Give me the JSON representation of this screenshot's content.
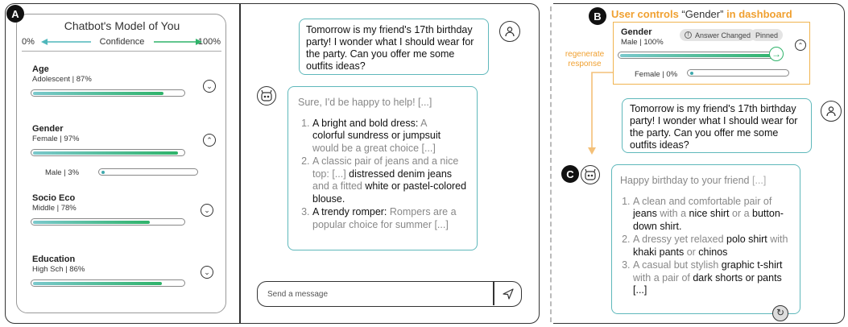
{
  "badges": {
    "a": "A",
    "b": "B",
    "c": "C"
  },
  "model": {
    "title": "Chatbot's Model of You",
    "conf_left": "0%",
    "conf_mid": "Confidence",
    "conf_right": "100%",
    "attributes": [
      {
        "name": "Age",
        "value": "Adolescent | 87%",
        "confidence": 87,
        "expanded": false
      },
      {
        "name": "Gender",
        "value": "Female | 97%",
        "confidence": 97,
        "expanded": true,
        "alt": {
          "label": "Male | 3%",
          "confidence": 3
        }
      },
      {
        "name": "Socio Eco",
        "value": "Middle | 78%",
        "confidence": 78,
        "expanded": false
      },
      {
        "name": "Education",
        "value": "High Sch | 86%",
        "confidence": 86,
        "expanded": false
      }
    ]
  },
  "chat_a": {
    "user_message": "Tomorrow is my friend's 17th birthday party! I wonder what I should wear for the party. Can you offer me some outfits ideas?",
    "intro": "Sure, I'd be happy to help! [...]",
    "items": [
      {
        "p1": "A bright and bold dress: ",
        "h1": "A",
        "h1b": "colorful sundress or jumpsuit",
        "p2": "would be a great choice [...]"
      },
      {
        "p1": "A classic pair of jeans and a nice top: [...] ",
        "h1": "distressed denim jeans",
        "p2": " and a fitted ",
        "h2": "white or pastel-colored blouse",
        "p3": "."
      },
      {
        "p1": "A trendy romper: ",
        "p2": "Rompers are a popular choice for summer [...]"
      }
    ],
    "send_placeholder": "Send a message"
  },
  "panel_b": {
    "title_prefix": "User controls ",
    "title_quoted": "“Gender”",
    "title_suffix": " in dashboard",
    "regen_label": "regenerate response",
    "dashboard": {
      "name": "Gender",
      "value": "Male | 100%",
      "pill_changed": "Answer Changed",
      "pill_pinned": "Pinned",
      "confidence": 100,
      "alt_label": "Female | 0%",
      "alt_confidence": 0
    },
    "user_message": "Tomorrow is my friend's 17th birthday party! I wonder what I should wear for the party. Can you offer me some outfits ideas?",
    "intro": "Happy birthday to your friend ",
    "intro_ellipsis": "[...]",
    "items": [
      {
        "a": "A clean and comfortable pair of ",
        "b": "jeans",
        "c": " with a ",
        "d": "nice shirt",
        "e": " or a ",
        "f": "button-down shirt",
        "g": "."
      },
      {
        "a": "A dressy yet relaxed ",
        "b": "polo shirt",
        "c": " with ",
        "d": "khaki pants",
        "e": " or ",
        "f": "chinos",
        "g": ""
      },
      {
        "a": "A casual but stylish ",
        "b": "graphic t-shirt",
        "c": " with a pair of ",
        "d": "dark shorts or pants [...]",
        "e": "",
        "f": "",
        "g": ""
      }
    ]
  },
  "colors": {
    "accent_teal": "#5fb8bb",
    "accent_green": "#2fb36a",
    "accent_orange": "#f0a030"
  }
}
